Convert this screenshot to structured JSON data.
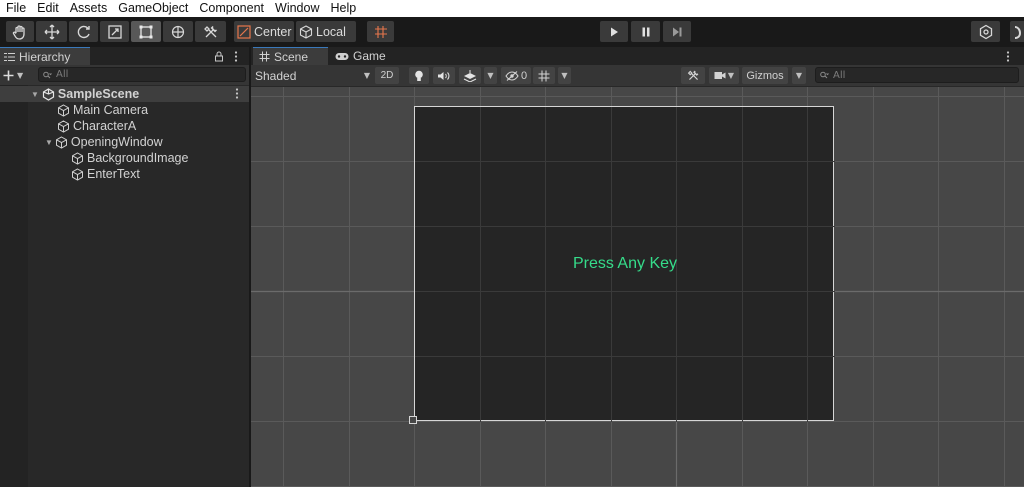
{
  "menu": [
    "File",
    "Edit",
    "Assets",
    "GameObject",
    "Component",
    "Window",
    "Help"
  ],
  "toolbar": {
    "tools": [
      "hand-tool",
      "move-tool",
      "rotate-tool",
      "scale-tool",
      "rect-tool",
      "transform-tool",
      "custom-tool"
    ],
    "active_tool": "rect-tool",
    "pivot_label": "Center",
    "space_label": "Local"
  },
  "hierarchy": {
    "title": "Hierarchy",
    "search_placeholder": "All",
    "scene": "SampleScene",
    "items": [
      {
        "label": "Main Camera",
        "depth": 1
      },
      {
        "label": "CharacterA",
        "depth": 1
      },
      {
        "label": "OpeningWindow",
        "depth": 1,
        "expanded": true
      },
      {
        "label": "BackgroundImage",
        "depth": 2
      },
      {
        "label": "EnterText",
        "depth": 2
      }
    ]
  },
  "scene_view": {
    "tabs": [
      {
        "label": "Scene",
        "icon": "grid-hash-icon",
        "active": true
      },
      {
        "label": "Game",
        "icon": "gamepad-icon",
        "active": false
      }
    ],
    "shading_mode": "Shaded",
    "mode_2d_label": "2D",
    "hidden_count": "0",
    "gizmos_label": "Gizmos",
    "search_placeholder": "All",
    "canvas_text": "Press Any Key",
    "canvas_text_color": "#35dc8a"
  },
  "colors": {
    "accent_tab": "#3a79bb",
    "viewport_bg": "#474747",
    "canvas_bg": "#252525"
  }
}
